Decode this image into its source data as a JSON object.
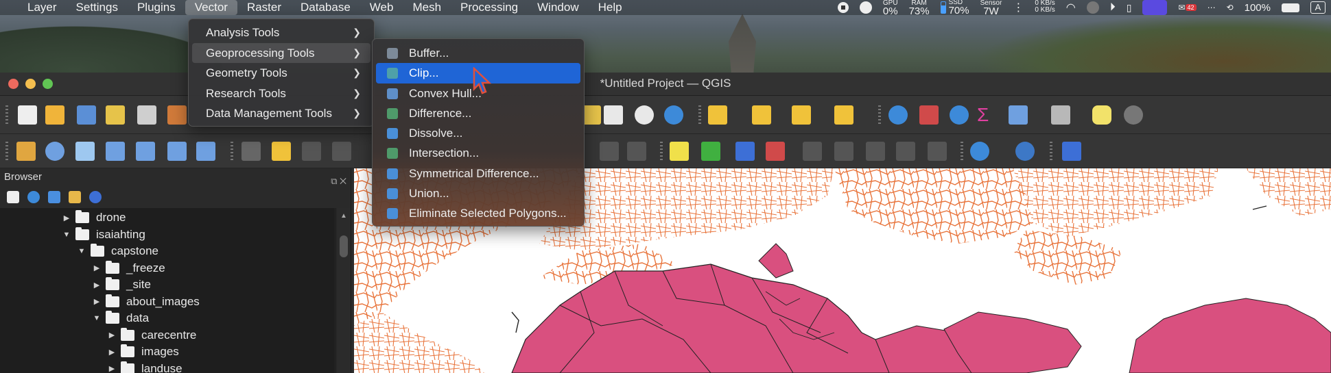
{
  "menubar": {
    "items": [
      "Layer",
      "Settings",
      "Plugins",
      "Vector",
      "Raster",
      "Database",
      "Web",
      "Mesh",
      "Processing",
      "Window",
      "Help"
    ],
    "active": "Vector"
  },
  "status": {
    "gpu_label": "GPU",
    "gpu_value": "0%",
    "ram_label": "RAM",
    "ram_value": "73%",
    "ssd_label": "SSD",
    "ssd_value": "70%",
    "sensor_label": "Sensor",
    "sensor_value": "7W",
    "net_up": "0 KB/s",
    "net_down": "0 KB/s",
    "notif_badge": "42",
    "battery": "100%",
    "input_source": "A"
  },
  "window": {
    "title": "*Untitled Project — QGIS"
  },
  "browser": {
    "title": "Browser",
    "tree": [
      {
        "label": "drone",
        "level": 0,
        "expanded": false
      },
      {
        "label": "isaiahting",
        "level": 0,
        "expanded": true
      },
      {
        "label": "capstone",
        "level": 1,
        "expanded": true
      },
      {
        "label": "_freeze",
        "level": 2,
        "expanded": false
      },
      {
        "label": "_site",
        "level": 2,
        "expanded": false
      },
      {
        "label": "about_images",
        "level": 2,
        "expanded": false
      },
      {
        "label": "data",
        "level": 2,
        "expanded": true
      },
      {
        "label": "carecentre",
        "level": 3,
        "expanded": false
      },
      {
        "label": "images",
        "level": 3,
        "expanded": false
      },
      {
        "label": "landuse",
        "level": 3,
        "expanded": false
      }
    ]
  },
  "vector_menu": {
    "items": [
      {
        "label": "Analysis Tools"
      },
      {
        "label": "Geoprocessing Tools"
      },
      {
        "label": "Geometry Tools"
      },
      {
        "label": "Research Tools"
      },
      {
        "label": "Data Management Tools"
      }
    ],
    "open": "Geoprocessing Tools"
  },
  "geoprocessing_menu": {
    "items": [
      {
        "label": "Buffer..."
      },
      {
        "label": "Clip..."
      },
      {
        "label": "Convex Hull..."
      },
      {
        "label": "Difference..."
      },
      {
        "label": "Dissolve..."
      },
      {
        "label": "Intersection..."
      },
      {
        "label": "Symmetrical Difference..."
      },
      {
        "label": "Union..."
      },
      {
        "label": "Eliminate Selected Polygons..."
      }
    ],
    "selected": "Clip..."
  },
  "colors": {
    "roads": "#e8733a",
    "landuse": "#d9507f",
    "selection": "#1f65d6"
  }
}
